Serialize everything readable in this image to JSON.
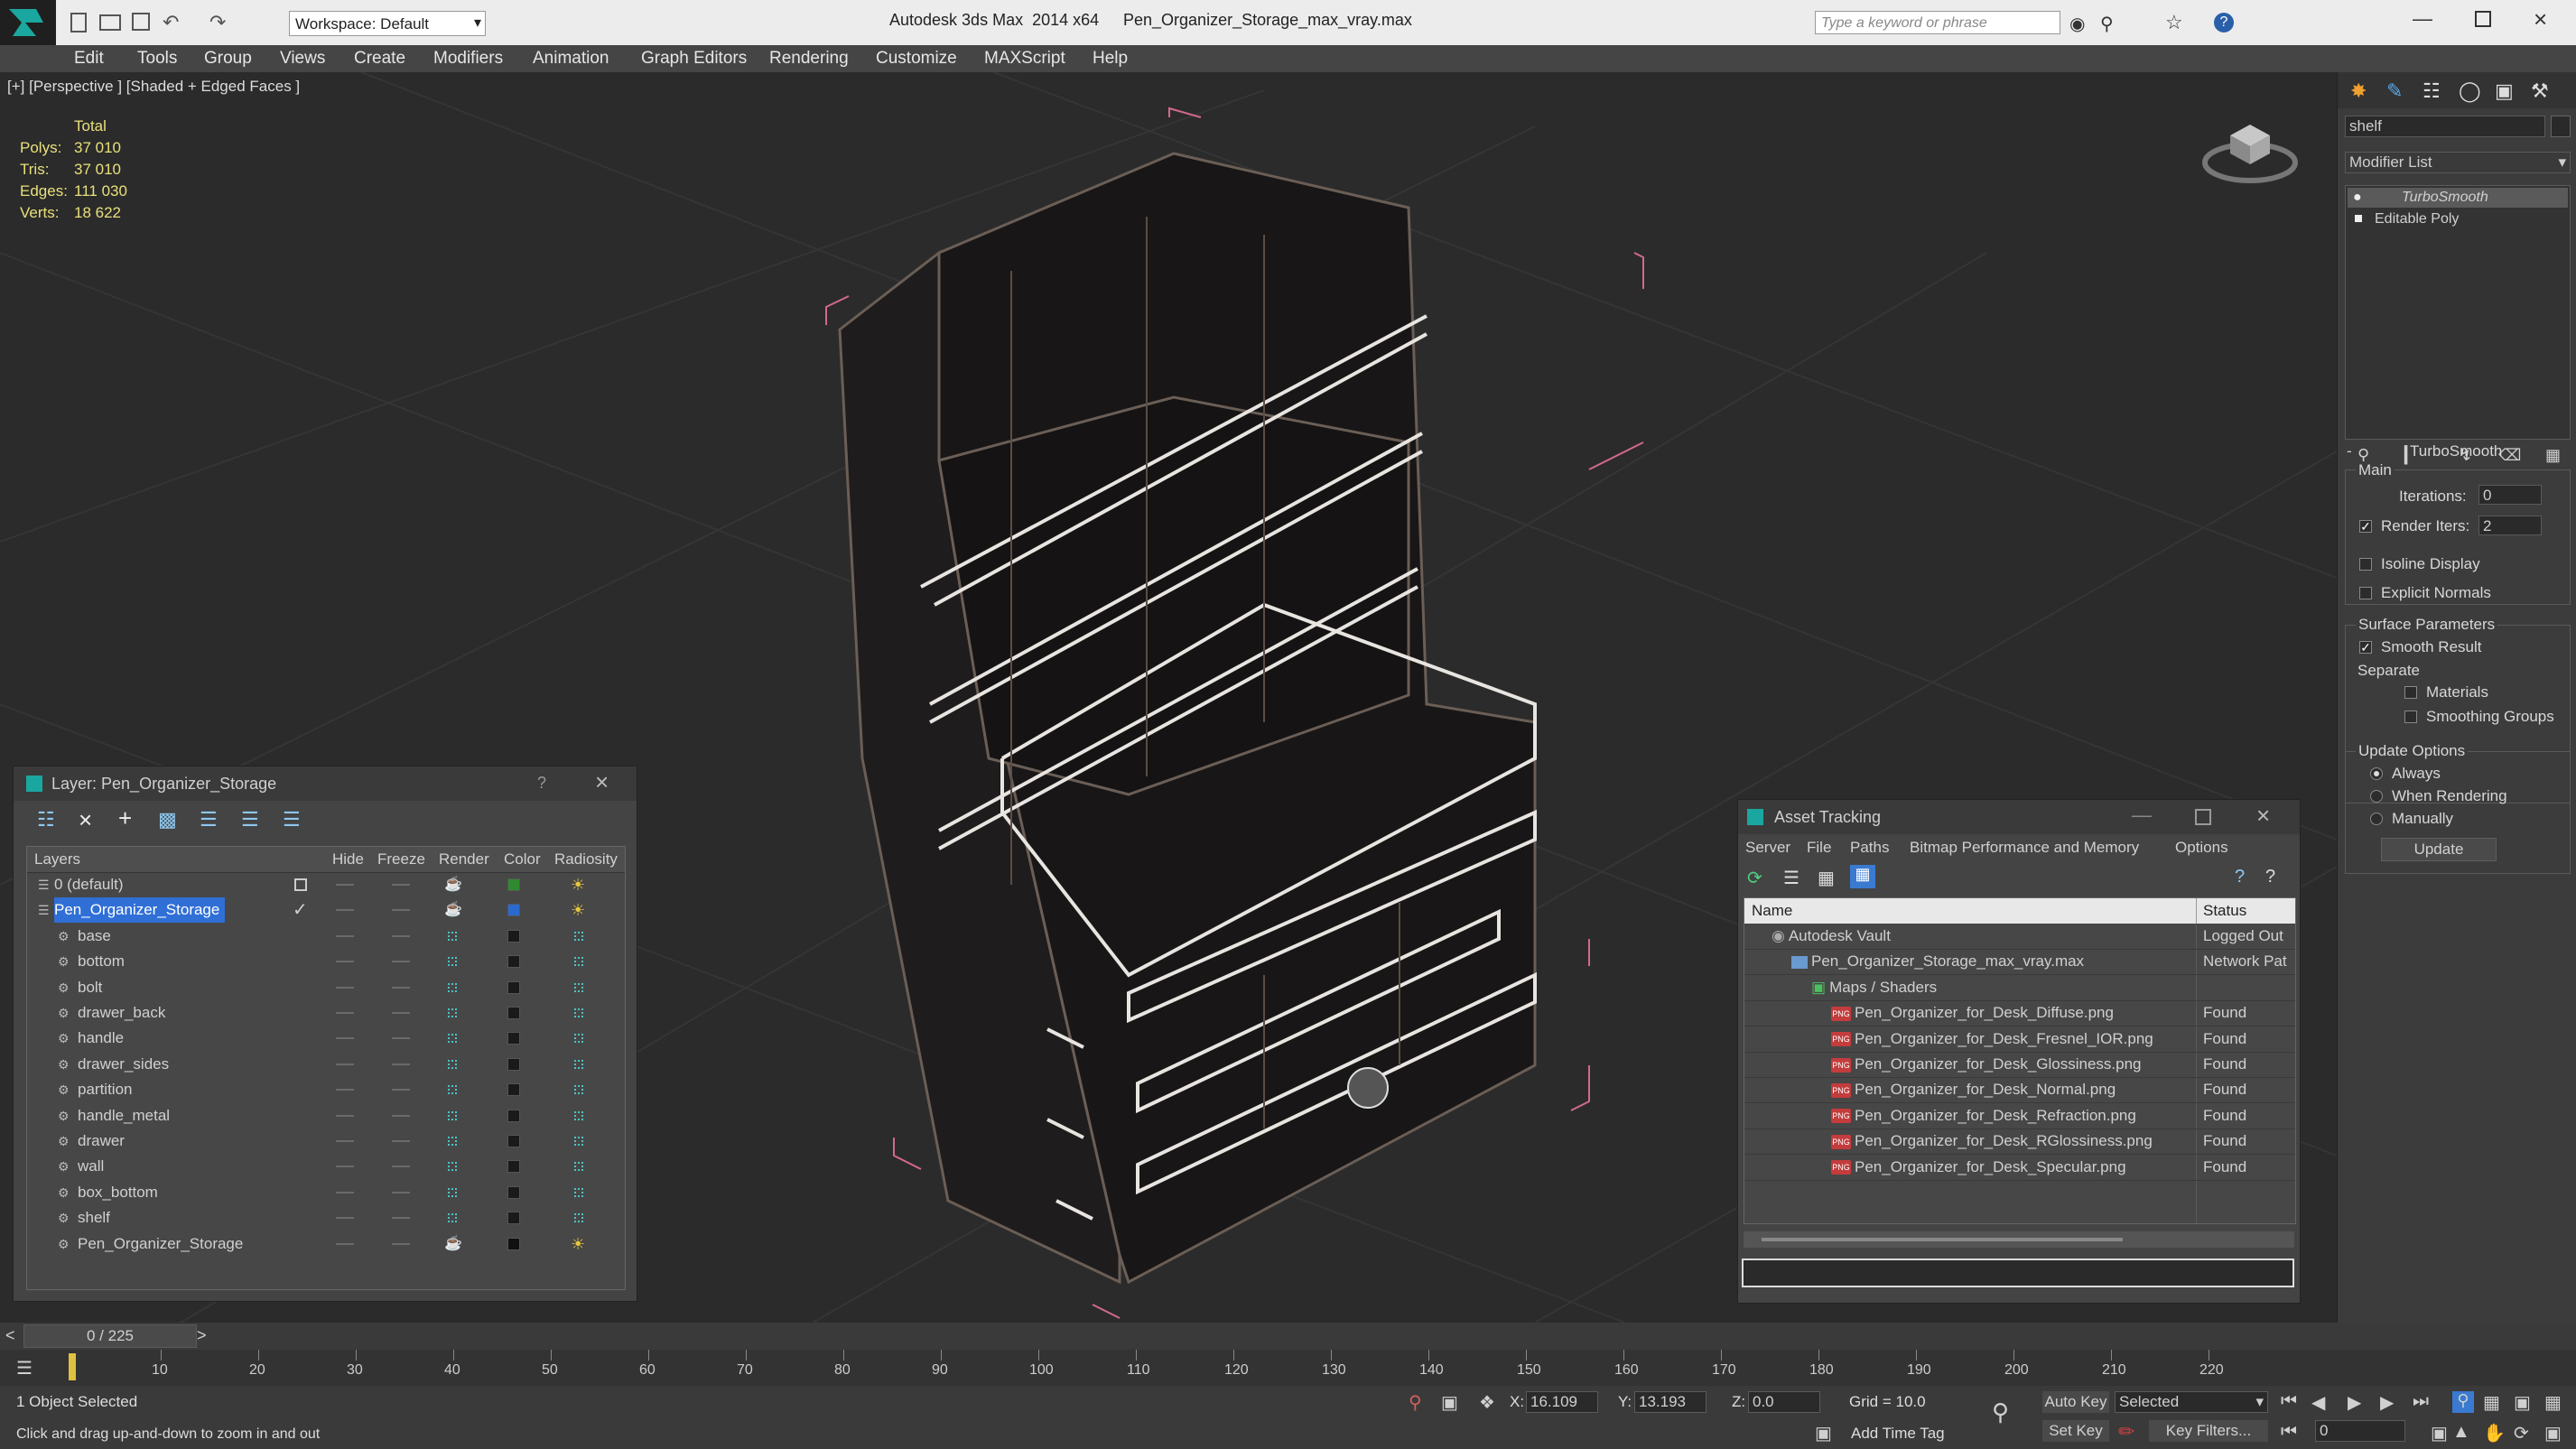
{
  "titlebar": {
    "workspace_label": "Workspace: Default",
    "app_title": "Autodesk 3ds Max  2014 x64",
    "file_title": "Pen_Organizer_Storage_max_vray.max",
    "search_placeholder": "Type a keyword or phrase"
  },
  "menu": [
    "Edit",
    "Tools",
    "Group",
    "Views",
    "Create",
    "Modifiers",
    "Animation",
    "Graph Editors",
    "Rendering",
    "Customize",
    "MAXScript",
    "Help"
  ],
  "viewport": {
    "label": "[+] [Perspective ] [Shaded + Edged Faces ]",
    "stats": {
      "header": "Total",
      "polys_label": "Polys:",
      "polys": "37 010",
      "tris_label": "Tris:",
      "tris": "37 010",
      "edges_label": "Edges:",
      "edges": "111 030",
      "verts_label": "Verts:",
      "verts": "18 622"
    }
  },
  "command_panel": {
    "object_name": "shelf",
    "modifier_list": "Modifier List",
    "stack": [
      "TurboSmooth",
      "Editable Poly"
    ],
    "rollout_title": "TurboSmooth",
    "main_label": "Main",
    "iterations_label": "Iterations:",
    "iterations": "0",
    "render_iters_label": "Render Iters:",
    "render_iters": "2",
    "isoline": "Isoline Display",
    "explicit_normals": "Explicit Normals",
    "surface_params": "Surface Parameters",
    "smooth_result": "Smooth Result",
    "separate": "Separate",
    "materials": "Materials",
    "smoothing_groups": "Smoothing Groups",
    "update_options": "Update Options",
    "always": "Always",
    "when_rendering": "When Rendering",
    "manually": "Manually",
    "update_button": "Update"
  },
  "layer_window": {
    "title": "Layer: Pen_Organizer_Storage",
    "help": "?",
    "columns": [
      "Layers",
      "Hide",
      "Freeze",
      "Render",
      "Color",
      "Radiosity"
    ],
    "rows": [
      {
        "name": "0 (default)",
        "color": "#2f8a2f",
        "level": 0
      },
      {
        "name": "Pen_Organizer_Storage",
        "color": "#2a6ad0",
        "level": 0,
        "selected": true
      },
      {
        "name": "base",
        "color": "#1a1a1a",
        "level": 1
      },
      {
        "name": "bottom",
        "color": "#1a1a1a",
        "level": 1
      },
      {
        "name": "bolt",
        "color": "#1a1a1a",
        "level": 1
      },
      {
        "name": "drawer_back",
        "color": "#1a1a1a",
        "level": 1
      },
      {
        "name": "handle",
        "color": "#1a1a1a",
        "level": 1
      },
      {
        "name": "drawer_sides",
        "color": "#1a1a1a",
        "level": 1
      },
      {
        "name": "partition",
        "color": "#1a1a1a",
        "level": 1
      },
      {
        "name": "handle_metal",
        "color": "#1a1a1a",
        "level": 1
      },
      {
        "name": "drawer",
        "color": "#1a1a1a",
        "level": 1
      },
      {
        "name": "wall",
        "color": "#1a1a1a",
        "level": 1
      },
      {
        "name": "box_bottom",
        "color": "#1a1a1a",
        "level": 1
      },
      {
        "name": "shelf",
        "color": "#1a1a1a",
        "level": 1
      },
      {
        "name": "Pen_Organizer_Storage",
        "color": "#111111",
        "level": 1
      }
    ]
  },
  "asset_window": {
    "title": "Asset Tracking",
    "menu": [
      "Server",
      "File",
      "Paths",
      "Bitmap Performance and Memory",
      "Options"
    ],
    "col_name": "Name",
    "col_status": "Status",
    "rows": [
      {
        "name": "Autodesk Vault",
        "status": "Logged Out",
        "level": 0
      },
      {
        "name": "Pen_Organizer_Storage_max_vray.max",
        "status": "Network Pat",
        "level": 1
      },
      {
        "name": "Maps / Shaders",
        "status": "",
        "level": 2
      },
      {
        "name": "Pen_Organizer_for_Desk_Diffuse.png",
        "status": "Found",
        "level": 3
      },
      {
        "name": "Pen_Organizer_for_Desk_Fresnel_IOR.png",
        "status": "Found",
        "level": 3
      },
      {
        "name": "Pen_Organizer_for_Desk_Glossiness.png",
        "status": "Found",
        "level": 3
      },
      {
        "name": "Pen_Organizer_for_Desk_Normal.png",
        "status": "Found",
        "level": 3
      },
      {
        "name": "Pen_Organizer_for_Desk_Refraction.png",
        "status": "Found",
        "level": 3
      },
      {
        "name": "Pen_Organizer_for_Desk_RGlossiness.png",
        "status": "Found",
        "level": 3
      },
      {
        "name": "Pen_Organizer_for_Desk_Specular.png",
        "status": "Found",
        "level": 3
      }
    ]
  },
  "timeline": {
    "frame": "0 / 225",
    "ticks": [
      "10",
      "20",
      "30",
      "40",
      "50",
      "60",
      "70",
      "80",
      "90",
      "100",
      "110",
      "120",
      "130",
      "140",
      "150",
      "160",
      "170",
      "180",
      "190",
      "200",
      "210",
      "220"
    ]
  },
  "status": {
    "selected": "1 Object Selected",
    "hint": "Click and drag up-and-down to zoom in and out",
    "x_label": "X:",
    "x": "16.109",
    "y_label": "Y:",
    "y": "13.193",
    "z_label": "Z:",
    "z": "0.0",
    "grid": "Grid = 10.0",
    "add_time_tag": "Add Time Tag",
    "auto_key": "Auto Key",
    "set_key": "Set Key",
    "selected_dropdown": "Selected",
    "key_filters": "Key Filters...",
    "frame_field": "0"
  }
}
